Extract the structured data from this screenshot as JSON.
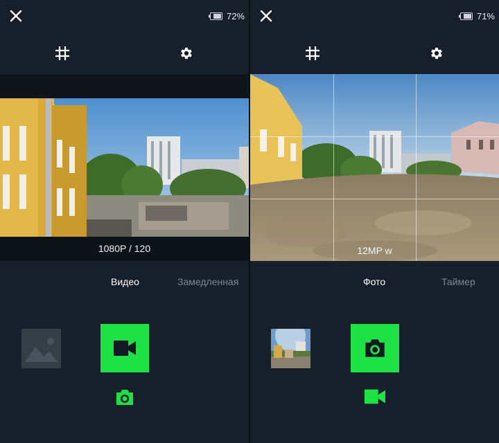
{
  "colors": {
    "accent": "#1ee145",
    "panel_bg": "#17202a",
    "inactive_text": "#7c8791"
  },
  "left_panel": {
    "battery_percent": "72%",
    "resolution_label": "1080P / 120",
    "modes": [
      "Видео",
      "Замедленная"
    ],
    "active_mode": "Видео",
    "grid_enabled": false,
    "shutter_icon": "video-camera-icon",
    "switch_icon": "camera-icon"
  },
  "right_panel": {
    "battery_percent": "71%",
    "resolution_label": "12MP w",
    "modes": [
      "Фото",
      "Таймер"
    ],
    "active_mode": "Фото",
    "grid_enabled": true,
    "shutter_icon": "camera-icon",
    "switch_icon": "video-camera-icon"
  }
}
